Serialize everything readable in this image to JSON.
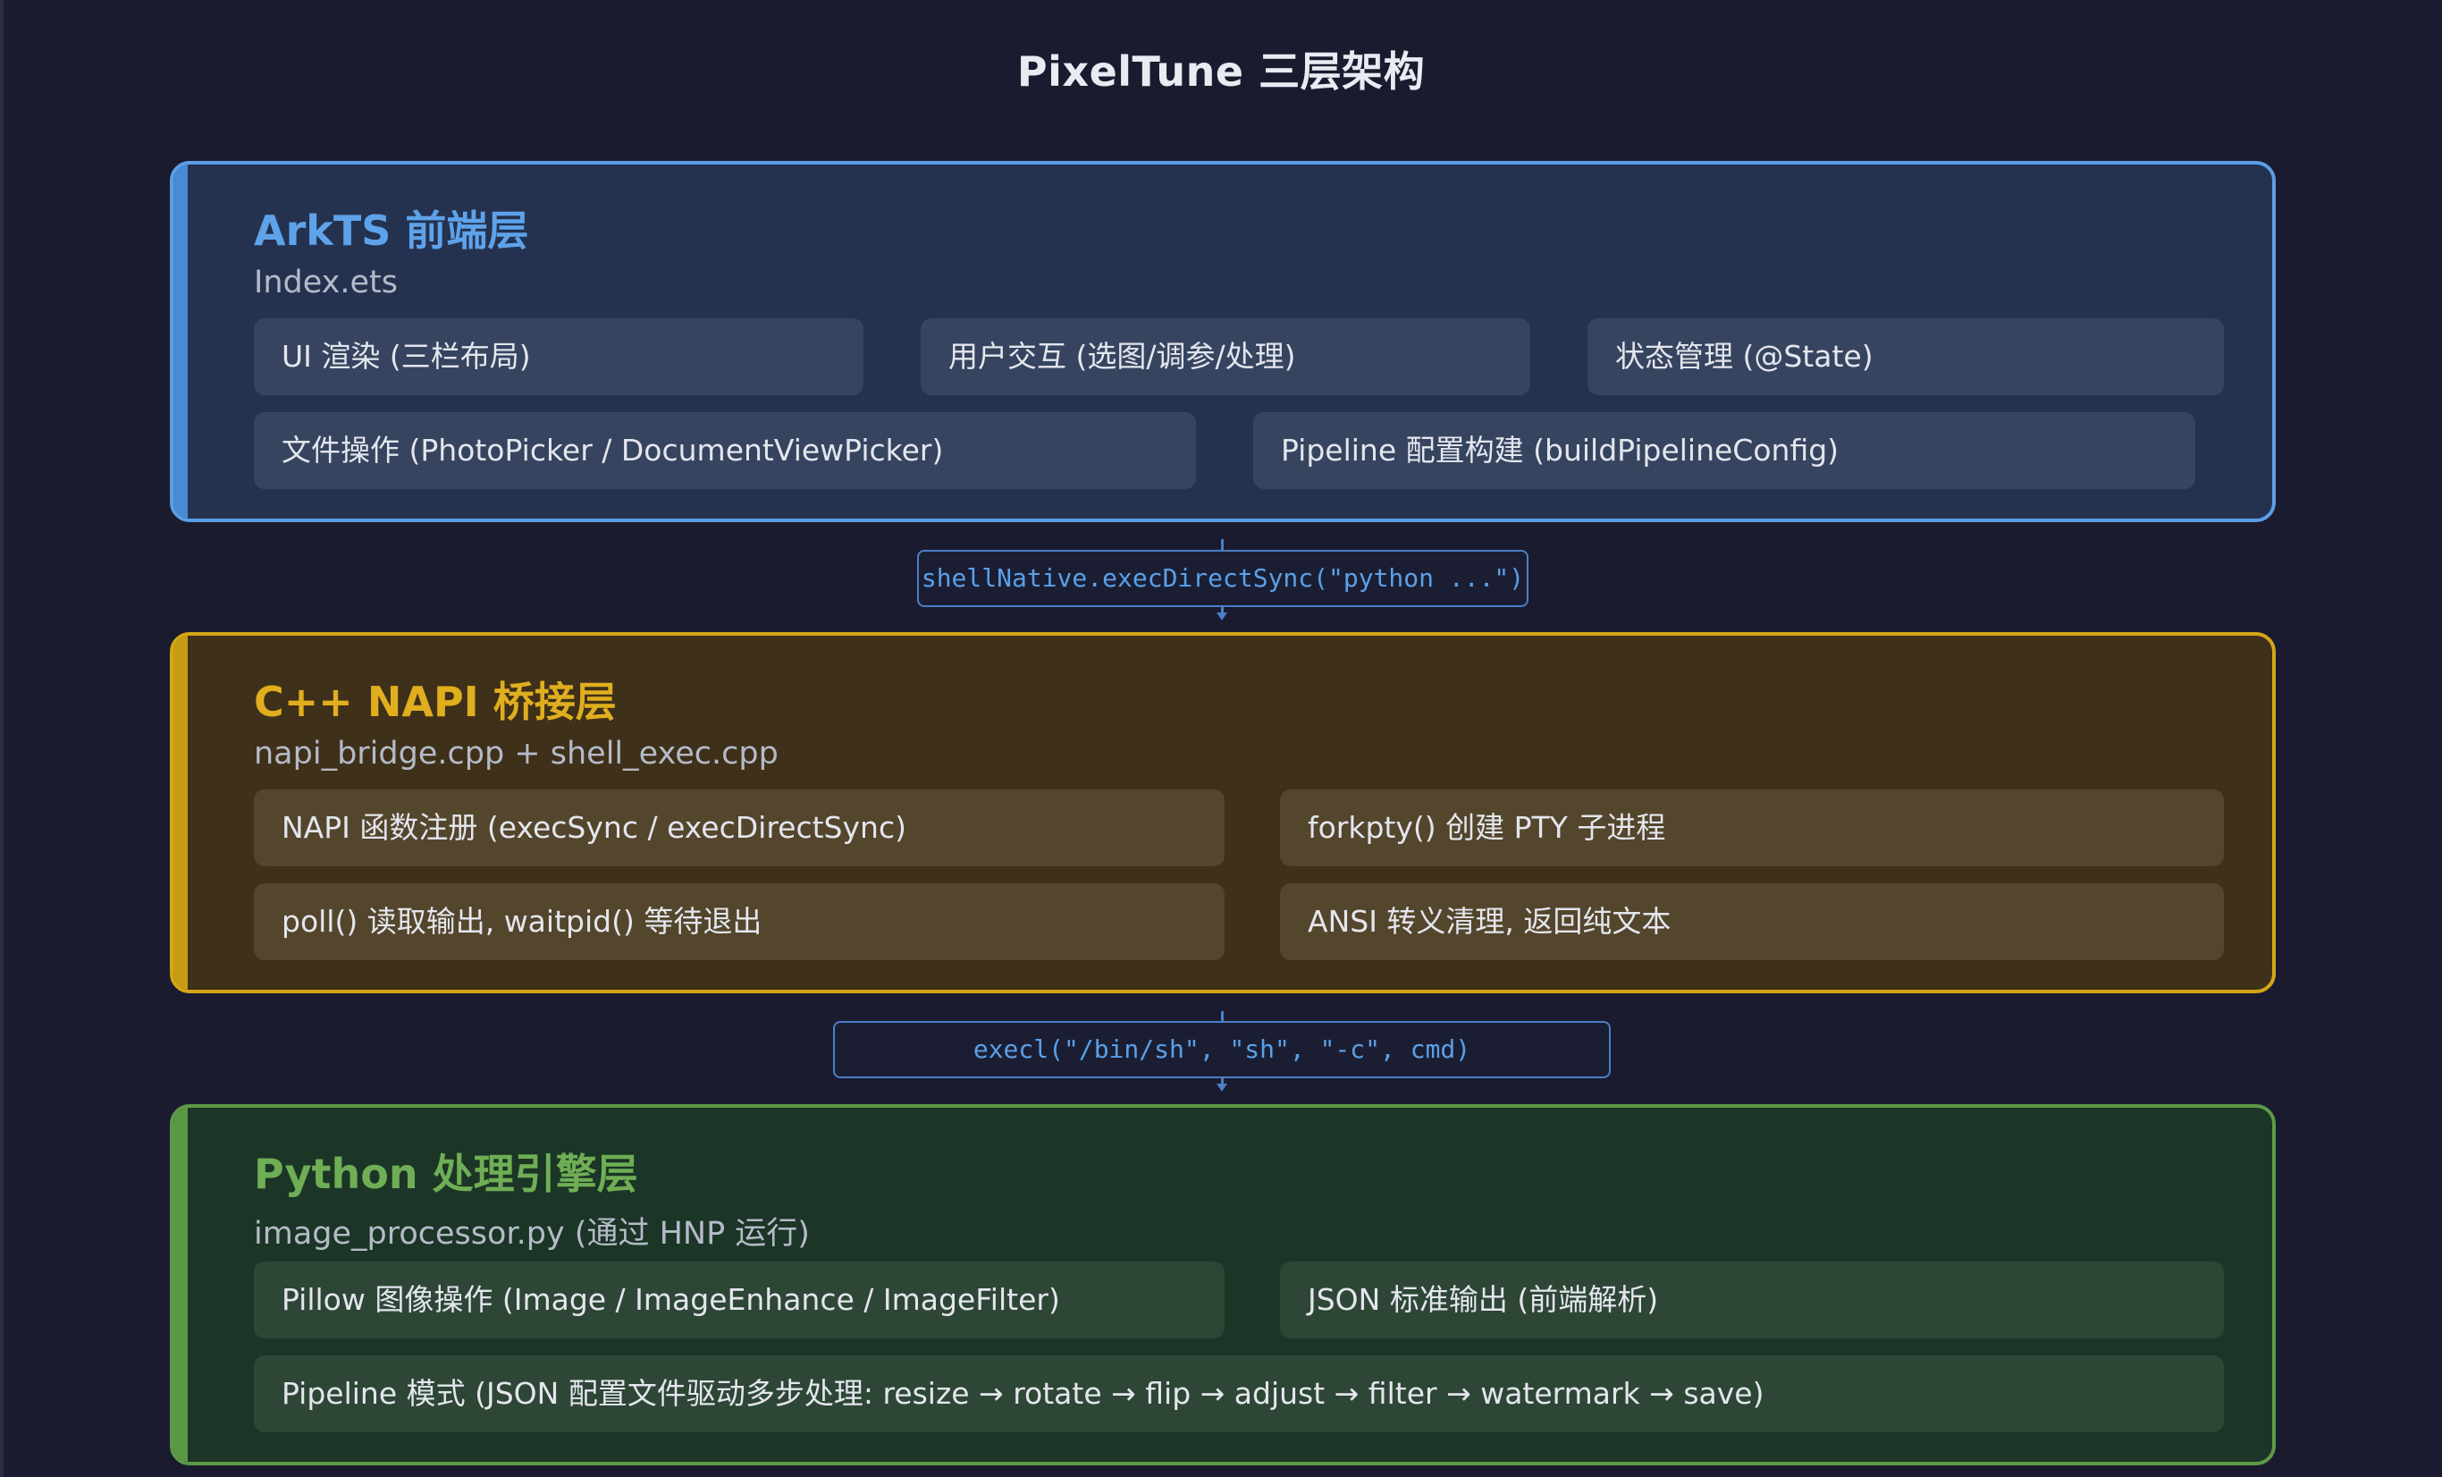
{
  "title": "PixelTune 三层架构",
  "layers": [
    {
      "title": "ArkTS 前端层",
      "subtitle": "Index.ets",
      "items": [
        "UI 渲染 (三栏布局)",
        "用户交互 (选图/调参/处理)",
        "状态管理 (@State)",
        "文件操作 (PhotoPicker / DocumentViewPicker)",
        "Pipeline 配置构建 (buildPipelineConfig)"
      ]
    },
    {
      "title": "C++ NAPI 桥接层",
      "subtitle": "napi_bridge.cpp + shell_exec.cpp",
      "items": [
        "NAPI 函数注册 (execSync / execDirectSync)",
        "forkpty() 创建 PTY 子进程",
        "poll() 读取输出, waitpid() 等待退出",
        "ANSI 转义清理, 返回纯文本"
      ]
    },
    {
      "title": "Python 处理引擎层",
      "subtitle": "image_processor.py (通过 HNP 运行)",
      "items": [
        "Pillow 图像操作 (Image / ImageEnhance / ImageFilter)",
        "JSON 标准输出 (前端解析)",
        "Pipeline 模式 (JSON 配置文件驱动多步处理: resize → rotate → flip → adjust → filter → watermark → save)"
      ]
    }
  ],
  "connectors": [
    "shellNative.execDirectSync(\"python ...\")",
    "execl(\"/bin/sh\", \"sh\", \"-c\", cmd)"
  ],
  "colors": {
    "background": "#1a1b2e",
    "frontend_accent": "#5a9ee6",
    "bridge_accent": "#d4a617",
    "engine_accent": "#5d9a48",
    "connector": "#4a7fc7"
  }
}
